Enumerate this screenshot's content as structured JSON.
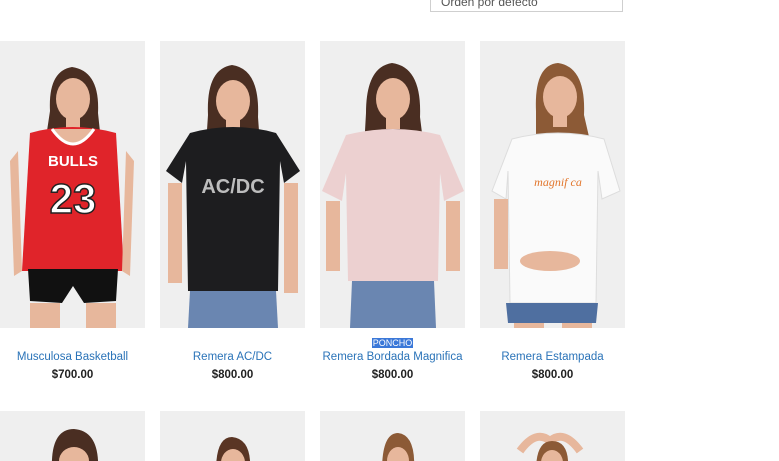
{
  "toolbar": {
    "sort_label": "Orden por defecto"
  },
  "products": [
    {
      "name": "Musculosa Basketball",
      "price": "$700.00",
      "badge": "",
      "shirt_color": "#e0242a",
      "print": "BULLS 23",
      "print_color": "#ffffff"
    },
    {
      "name": "Remera AC/DC",
      "price": "$800.00",
      "badge": "",
      "shirt_color": "#1d1d1f",
      "print": "AC/DC",
      "print_color": "#bdbdbd"
    },
    {
      "name": "Remera Bordada Magnifica",
      "price": "$800.00",
      "badge": "PONCHO",
      "shirt_color": "#ecd0d0",
      "print": "",
      "print_color": "#ecd0d0"
    },
    {
      "name": "Remera Estampada",
      "price": "$800.00",
      "badge": "",
      "shirt_color": "#fafafa",
      "print": "magnif ca",
      "print_color": "#e2762c"
    }
  ],
  "colors": {
    "link": "#2a73b8",
    "badge_bg": "#3b78d8"
  }
}
